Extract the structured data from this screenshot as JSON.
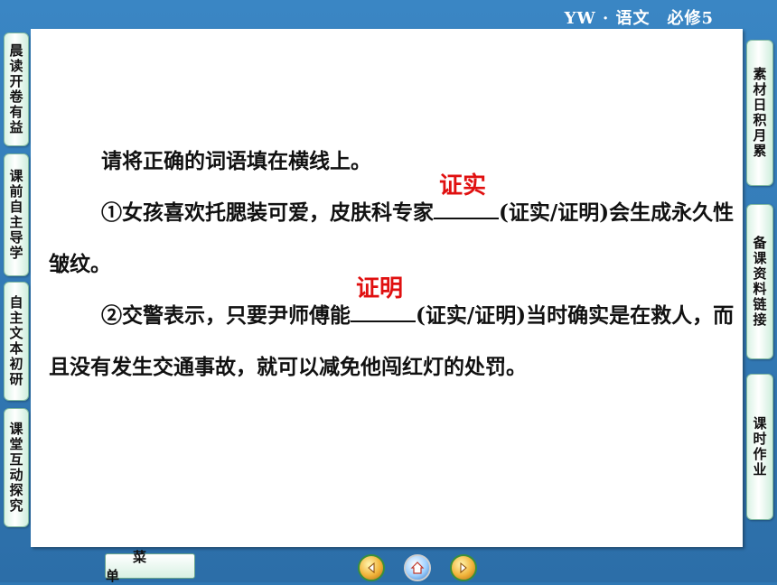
{
  "header": {
    "title": "YW · 语文　必修5"
  },
  "left_tabs": [
    {
      "label": "晨读开卷有益"
    },
    {
      "label": "课前自主导学"
    },
    {
      "label": "自主文本初研"
    },
    {
      "label": "课堂互动探究"
    }
  ],
  "right_tabs": [
    {
      "label": "素材日积月累"
    },
    {
      "label": "备课资料链接"
    },
    {
      "label": "课时作业"
    }
  ],
  "content": {
    "instruction": "请将正确的词语填在横线上。",
    "q1": {
      "prefix": "①女孩喜欢托腮装可爱，皮肤科专家",
      "answer": "证实",
      "suffix": "(证实/证明)会生成永久性皱纹。"
    },
    "q2": {
      "prefix": "②交警表示，只要尹师傅能",
      "answer": "证明",
      "suffix": "(证实/证明)当时确实是在救人，而且没有发生交通事故，就可以减免他闯红灯的处罚。"
    }
  },
  "footer": {
    "menu_label": "菜单",
    "prev_icon": "arrow-left-icon",
    "home_icon": "home-icon",
    "next_icon": "arrow-right-icon"
  },
  "colors": {
    "background": "#2f78b4",
    "answer": "#e01010",
    "tab": "#d9f3e4"
  }
}
